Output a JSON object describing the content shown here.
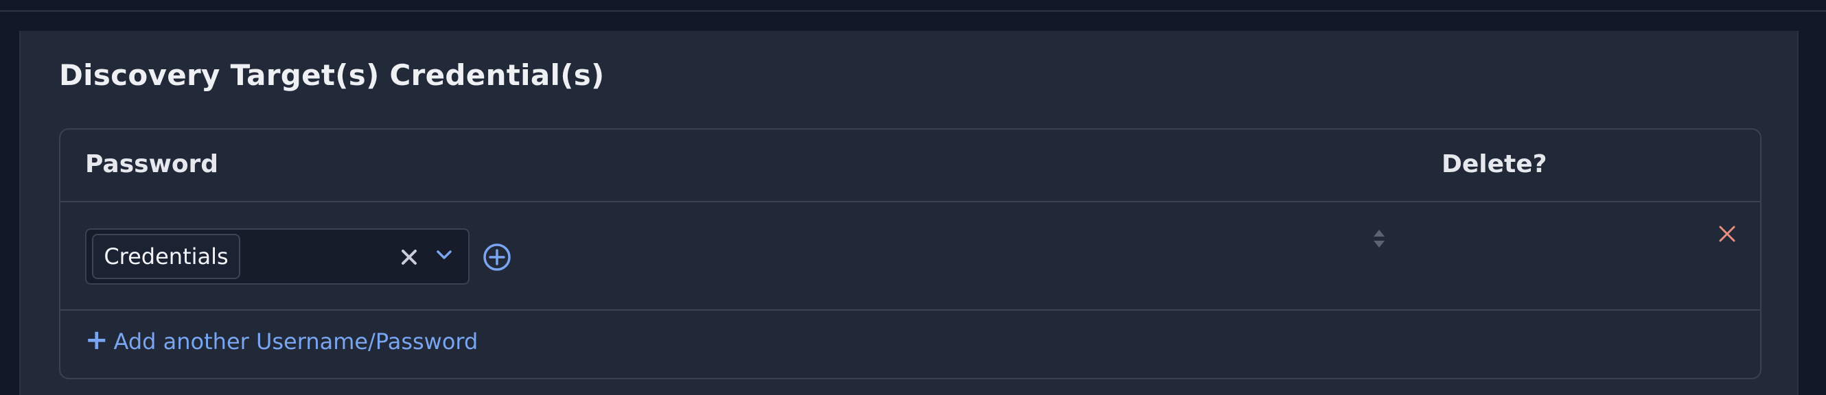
{
  "section": {
    "title": "Discovery Target(s) Credential(s)"
  },
  "table": {
    "columns": {
      "password": "Password",
      "delete": "Delete?"
    },
    "rows": [
      {
        "selected_chip": "Credentials"
      }
    ],
    "add_link_plus": "+",
    "add_link_label": "Add another Username/Password"
  },
  "icons": {
    "clear": "close-icon",
    "dropdown": "chevron-down-icon",
    "add": "plus-circle-icon",
    "sort": "sort-icon",
    "delete": "close-icon"
  },
  "colors": {
    "accent": "#7aa5f0",
    "delete": "#e8907f",
    "panel": "#222938",
    "background": "#111827"
  }
}
